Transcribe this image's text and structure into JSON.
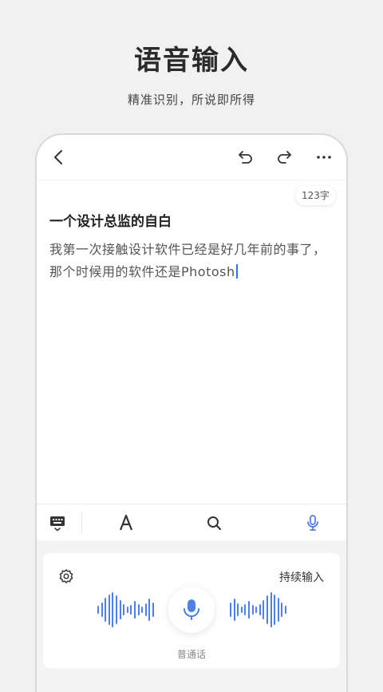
{
  "promo": {
    "title": "语音输入",
    "subtitle": "精准识别，所说即所得"
  },
  "topbar": {
    "back_icon": "chevron-left-icon",
    "undo_icon": "undo-icon",
    "redo_icon": "redo-icon",
    "more_icon": "more-horizontal-icon"
  },
  "note": {
    "word_count": "123字",
    "title": "一个设计总监的自白",
    "body": "我第一次接触设计软件已经是好几年前的事了，那个时候用的软件还是Photosh"
  },
  "toolbar": {
    "items": [
      "keyboard-icon",
      "font-icon",
      "search-icon",
      "mic-icon"
    ],
    "active": "mic-icon",
    "accent_color": "#4f7fe8"
  },
  "voice": {
    "settings_icon": "gear-icon",
    "continuous_label": "持续输入",
    "mic_icon": "mic-icon",
    "language_label": "普通话"
  }
}
